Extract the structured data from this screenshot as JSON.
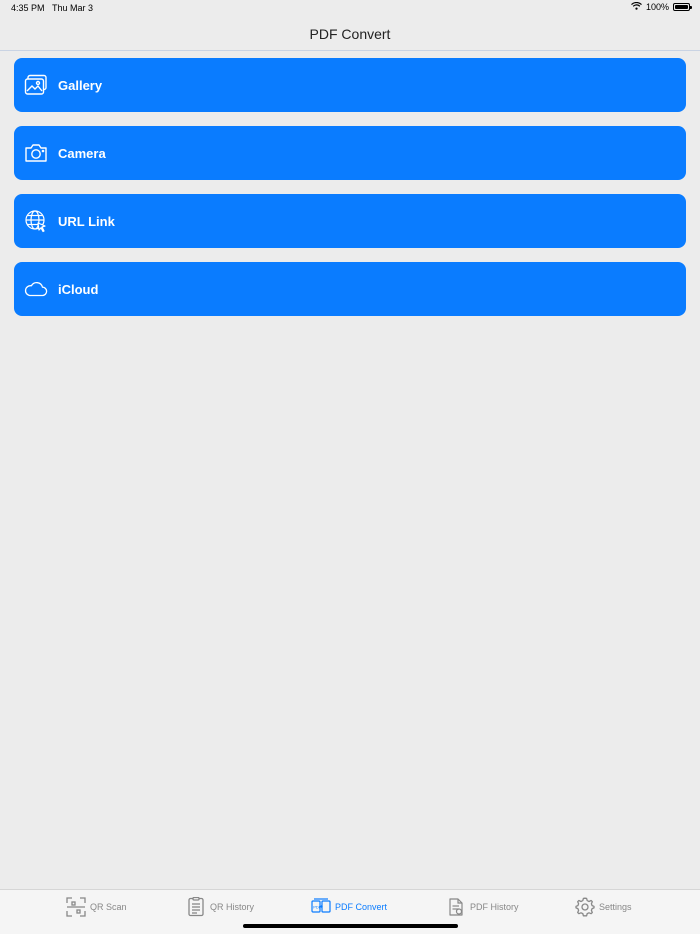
{
  "status": {
    "time": "4:35 PM",
    "date": "Thu Mar 3",
    "battery": "100%"
  },
  "nav": {
    "title": "PDF Convert"
  },
  "sources": [
    {
      "label": "Gallery",
      "icon": "gallery-icon"
    },
    {
      "label": "Camera",
      "icon": "camera-icon"
    },
    {
      "label": "URL Link",
      "icon": "url-link-icon"
    },
    {
      "label": "iCloud",
      "icon": "icloud-icon"
    }
  ],
  "tabs": [
    {
      "label": "QR Scan",
      "icon": "qr-scan-icon",
      "active": false
    },
    {
      "label": "QR History",
      "icon": "qr-history-icon",
      "active": false
    },
    {
      "label": "PDF Convert",
      "icon": "pdf-convert-icon",
      "active": true
    },
    {
      "label": "PDF History",
      "icon": "pdf-history-icon",
      "active": false
    },
    {
      "label": "Settings",
      "icon": "settings-icon",
      "active": false
    }
  ],
  "colors": {
    "accent": "#0a7cff",
    "background": "#ececec",
    "tab_inactive": "#888888"
  }
}
